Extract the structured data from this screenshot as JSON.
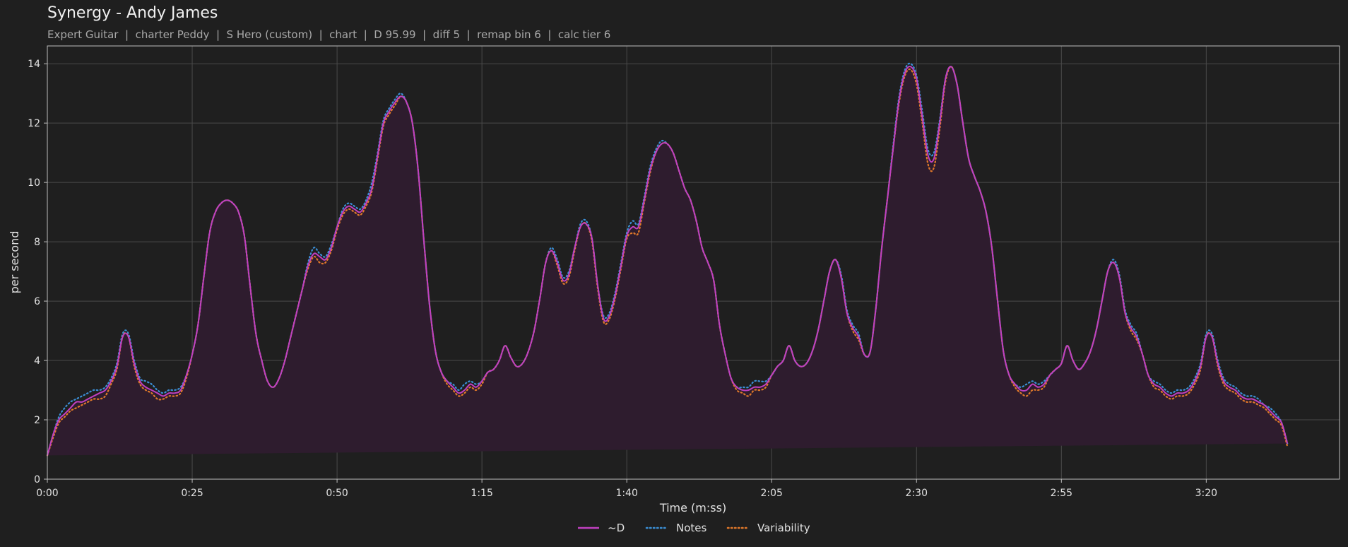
{
  "header": {
    "title": "Synergy - Andy James",
    "subtitle": "Expert Guitar  |  charter Peddy  |  S Hero (custom)  |  chart  |  D 95.99  |  diff 5  |  remap bin 6  |  calc tier 6"
  },
  "colors": {
    "background": "#1f1f1f",
    "plot_bg": "#1f1f1f",
    "grid": "#4a4a4a",
    "frame": "#bdbdbd",
    "fill": "#2e1c2e",
    "d": "#c040c0",
    "notes": "#3b8fd6",
    "variability": "#e0782a"
  },
  "chart_data": {
    "type": "line",
    "title": "Synergy - Andy James",
    "xlabel": "Time (m:ss)",
    "ylabel": "per second",
    "xlim": [
      0,
      223
    ],
    "ylim": [
      0,
      14.6
    ],
    "x_tick_values": [
      0,
      25,
      50,
      75,
      100,
      125,
      150,
      175,
      200
    ],
    "x_tick_labels": [
      "0:00",
      "0:25",
      "0:50",
      "1:15",
      "1:40",
      "2:05",
      "2:30",
      "2:55",
      "3:20"
    ],
    "y_ticks": [
      0,
      2,
      4,
      6,
      8,
      10,
      12,
      14
    ],
    "grid": true,
    "legend_position": "bottom-center",
    "x": [
      0,
      1,
      2,
      3,
      4,
      5,
      6,
      7,
      8,
      9,
      10,
      11,
      12,
      13,
      14,
      15,
      16,
      17,
      18,
      19,
      20,
      21,
      22,
      23,
      24,
      25,
      26,
      27,
      28,
      29,
      30,
      31,
      32,
      33,
      34,
      35,
      36,
      37,
      38,
      39,
      40,
      41,
      42,
      43,
      44,
      45,
      46,
      47,
      48,
      49,
      50,
      51,
      52,
      53,
      54,
      55,
      56,
      57,
      58,
      59,
      60,
      61,
      62,
      63,
      64,
      65,
      66,
      67,
      68,
      69,
      70,
      71,
      72,
      73,
      74,
      75,
      76,
      77,
      78,
      79,
      80,
      81,
      82,
      83,
      84,
      85,
      86,
      87,
      88,
      89,
      90,
      91,
      92,
      93,
      94,
      95,
      96,
      97,
      98,
      99,
      100,
      101,
      102,
      103,
      104,
      105,
      106,
      107,
      108,
      109,
      110,
      111,
      112,
      113,
      114,
      115,
      116,
      117,
      118,
      119,
      120,
      121,
      122,
      123,
      124,
      125,
      126,
      127,
      128,
      129,
      130,
      131,
      132,
      133,
      134,
      135,
      136,
      137,
      138,
      139,
      140,
      141,
      142,
      143,
      144,
      145,
      146,
      147,
      148,
      149,
      150,
      151,
      152,
      153,
      154,
      155,
      156,
      157,
      158,
      159,
      160,
      161,
      162,
      163,
      164,
      165,
      166,
      167,
      168,
      169,
      170,
      171,
      172,
      173,
      174,
      175,
      176,
      177,
      178,
      179,
      180,
      181,
      182,
      183,
      184,
      185,
      186,
      187,
      188,
      189,
      190,
      191,
      192,
      193,
      194,
      195,
      196,
      197,
      198,
      199,
      200,
      201,
      202,
      203,
      204,
      205,
      206,
      207,
      208,
      209,
      210,
      211,
      212,
      213,
      214,
      215,
      216,
      217,
      218,
      219,
      220,
      221,
      222,
      223
    ],
    "series": [
      {
        "name": "~D",
        "style": "solid",
        "values": [
          0.8,
          1.5,
          2.0,
          2.2,
          2.4,
          2.6,
          2.6,
          2.7,
          2.8,
          2.9,
          3.0,
          3.3,
          3.8,
          4.8,
          4.8,
          3.9,
          3.3,
          3.1,
          3.0,
          2.9,
          2.8,
          2.9,
          2.9,
          3.0,
          3.5,
          4.2,
          5.2,
          6.8,
          8.3,
          9.0,
          9.3,
          9.4,
          9.3,
          9.0,
          8.2,
          6.5,
          4.9,
          4.0,
          3.3,
          3.1,
          3.4,
          4.0,
          4.8,
          5.6,
          6.4,
          7.2,
          7.6,
          7.5,
          7.4,
          7.8,
          8.5,
          9.0,
          9.2,
          9.1,
          9.0,
          9.3,
          9.8,
          10.9,
          12.0,
          12.4,
          12.7,
          12.9,
          12.7,
          12.0,
          10.4,
          8.0,
          5.8,
          4.3,
          3.6,
          3.3,
          3.1,
          2.9,
          3.0,
          3.2,
          3.1,
          3.3,
          3.6,
          3.7,
          4.0,
          4.5,
          4.1,
          3.8,
          3.9,
          4.3,
          5.0,
          6.1,
          7.3,
          7.7,
          7.3,
          6.7,
          6.9,
          7.8,
          8.5,
          8.6,
          8.1,
          6.5,
          5.4,
          5.5,
          6.2,
          7.2,
          8.2,
          8.5,
          8.5,
          9.4,
          10.4,
          11.0,
          11.3,
          11.3,
          11.0,
          10.4,
          9.8,
          9.4,
          8.7,
          7.8,
          7.3,
          6.7,
          5.2,
          4.2,
          3.4,
          3.1,
          3.0,
          3.0,
          3.1,
          3.1,
          3.2,
          3.5,
          3.8,
          4.0,
          4.5,
          4.0,
          3.8,
          3.9,
          4.3,
          5.0,
          6.0,
          7.0,
          7.4,
          6.8,
          5.6,
          5.1,
          4.8,
          4.2,
          4.3,
          5.8,
          7.8,
          9.5,
          11.2,
          12.8,
          13.7,
          13.9,
          13.5,
          12.2,
          10.9,
          10.8,
          12.0,
          13.5,
          13.9,
          13.3,
          12.0,
          10.8,
          10.2,
          9.7,
          9.0,
          7.8,
          6.0,
          4.3,
          3.5,
          3.2,
          3.0,
          3.0,
          3.2,
          3.1,
          3.2,
          3.5,
          3.7,
          3.9,
          4.5,
          4.0,
          3.7,
          3.9,
          4.3,
          5.0,
          6.0,
          7.0,
          7.3,
          6.8,
          5.6,
          5.1,
          4.8,
          4.2,
          3.5,
          3.2,
          3.1,
          2.9,
          2.8,
          2.9,
          2.9,
          3.0,
          3.3,
          3.8,
          4.8,
          4.8,
          3.9,
          3.3,
          3.1,
          3.0,
          2.8,
          2.7,
          2.7,
          2.6,
          2.5,
          2.3,
          2.1,
          1.9,
          1.2,
          0.3
        ]
      },
      {
        "name": "Notes",
        "style": "dotted",
        "values": [
          0.8,
          1.5,
          2.1,
          2.4,
          2.6,
          2.7,
          2.8,
          2.9,
          3.0,
          3.0,
          3.1,
          3.4,
          3.9,
          4.9,
          4.9,
          4.0,
          3.4,
          3.3,
          3.2,
          3.0,
          2.9,
          3.0,
          3.0,
          3.1,
          3.5,
          4.2,
          5.2,
          6.8,
          8.3,
          9.0,
          9.3,
          9.4,
          9.3,
          9.0,
          8.2,
          6.5,
          4.9,
          4.0,
          3.3,
          3.1,
          3.4,
          4.0,
          4.8,
          5.6,
          6.4,
          7.3,
          7.8,
          7.6,
          7.5,
          7.9,
          8.5,
          9.1,
          9.3,
          9.2,
          9.1,
          9.4,
          10.0,
          11.0,
          12.1,
          12.5,
          12.8,
          13.0,
          12.7,
          12.0,
          10.4,
          8.0,
          5.8,
          4.3,
          3.6,
          3.3,
          3.2,
          3.0,
          3.2,
          3.3,
          3.2,
          3.3,
          3.6,
          3.7,
          4.0,
          4.5,
          4.1,
          3.8,
          3.9,
          4.3,
          5.0,
          6.1,
          7.3,
          7.8,
          7.4,
          6.8,
          7.0,
          7.8,
          8.6,
          8.7,
          8.1,
          6.5,
          5.5,
          5.6,
          6.3,
          7.3,
          8.3,
          8.7,
          8.6,
          9.5,
          10.5,
          11.1,
          11.4,
          11.3,
          11.0,
          10.4,
          9.8,
          9.4,
          8.7,
          7.8,
          7.3,
          6.7,
          5.2,
          4.2,
          3.4,
          3.1,
          3.1,
          3.1,
          3.3,
          3.3,
          3.3,
          3.5,
          3.8,
          4.0,
          4.5,
          4.0,
          3.8,
          3.9,
          4.3,
          5.0,
          6.0,
          7.0,
          7.4,
          6.9,
          5.7,
          5.2,
          4.9,
          4.2,
          4.3,
          5.8,
          7.8,
          9.5,
          11.3,
          12.9,
          13.8,
          14.0,
          13.6,
          12.4,
          11.1,
          11.0,
          12.1,
          13.5,
          13.9,
          13.3,
          12.0,
          10.8,
          10.2,
          9.7,
          9.0,
          7.8,
          6.0,
          4.3,
          3.5,
          3.2,
          3.1,
          3.2,
          3.3,
          3.2,
          3.3,
          3.5,
          3.7,
          3.9,
          4.5,
          4.0,
          3.7,
          3.9,
          4.3,
          5.0,
          6.0,
          7.0,
          7.4,
          6.9,
          5.7,
          5.2,
          4.9,
          4.2,
          3.5,
          3.3,
          3.2,
          3.0,
          2.9,
          3.0,
          3.0,
          3.1,
          3.4,
          3.9,
          4.9,
          4.9,
          4.0,
          3.4,
          3.2,
          3.1,
          2.9,
          2.8,
          2.8,
          2.7,
          2.5,
          2.4,
          2.2,
          1.9,
          1.2,
          0.3
        ]
      },
      {
        "name": "Variability",
        "style": "dotted",
        "values": [
          0.8,
          1.4,
          1.9,
          2.1,
          2.3,
          2.4,
          2.5,
          2.6,
          2.7,
          2.7,
          2.8,
          3.2,
          3.7,
          4.8,
          4.8,
          3.8,
          3.2,
          3.0,
          2.9,
          2.7,
          2.7,
          2.8,
          2.8,
          2.9,
          3.4,
          4.2,
          5.2,
          6.8,
          8.3,
          9.0,
          9.3,
          9.4,
          9.3,
          9.0,
          8.2,
          6.5,
          4.9,
          4.0,
          3.3,
          3.1,
          3.4,
          4.0,
          4.8,
          5.6,
          6.4,
          7.1,
          7.5,
          7.3,
          7.3,
          7.7,
          8.4,
          8.9,
          9.1,
          9.0,
          8.9,
          9.2,
          9.7,
          10.8,
          11.9,
          12.3,
          12.6,
          12.9,
          12.7,
          12.0,
          10.4,
          8.0,
          5.8,
          4.3,
          3.6,
          3.2,
          3.0,
          2.8,
          2.9,
          3.1,
          3.0,
          3.2,
          3.6,
          3.7,
          4.0,
          4.5,
          4.1,
          3.8,
          3.9,
          4.3,
          5.0,
          6.1,
          7.3,
          7.7,
          7.2,
          6.6,
          6.8,
          7.7,
          8.5,
          8.6,
          8.0,
          6.4,
          5.3,
          5.4,
          6.1,
          7.1,
          8.1,
          8.3,
          8.3,
          9.3,
          10.3,
          11.0,
          11.3,
          11.3,
          11.0,
          10.4,
          9.8,
          9.4,
          8.7,
          7.8,
          7.3,
          6.7,
          5.2,
          4.2,
          3.4,
          3.0,
          2.9,
          2.8,
          3.0,
          3.0,
          3.1,
          3.5,
          3.8,
          4.0,
          4.5,
          4.0,
          3.8,
          3.9,
          4.3,
          5.0,
          6.0,
          7.0,
          7.4,
          6.8,
          5.6,
          5.0,
          4.7,
          4.2,
          4.3,
          5.8,
          7.8,
          9.5,
          11.2,
          12.7,
          13.6,
          13.8,
          13.3,
          12.0,
          10.6,
          10.5,
          11.8,
          13.4,
          13.9,
          13.3,
          12.0,
          10.8,
          10.2,
          9.7,
          9.0,
          7.8,
          6.0,
          4.3,
          3.5,
          3.1,
          2.9,
          2.8,
          3.0,
          3.0,
          3.1,
          3.5,
          3.7,
          3.9,
          4.5,
          4.0,
          3.7,
          3.9,
          4.3,
          5.0,
          6.0,
          7.0,
          7.3,
          6.8,
          5.6,
          5.0,
          4.7,
          4.2,
          3.5,
          3.1,
          3.0,
          2.8,
          2.7,
          2.8,
          2.8,
          2.9,
          3.2,
          3.7,
          4.8,
          4.8,
          3.8,
          3.2,
          3.0,
          2.9,
          2.7,
          2.6,
          2.6,
          2.5,
          2.4,
          2.2,
          2.0,
          1.8,
          1.1,
          0.3
        ]
      }
    ]
  }
}
